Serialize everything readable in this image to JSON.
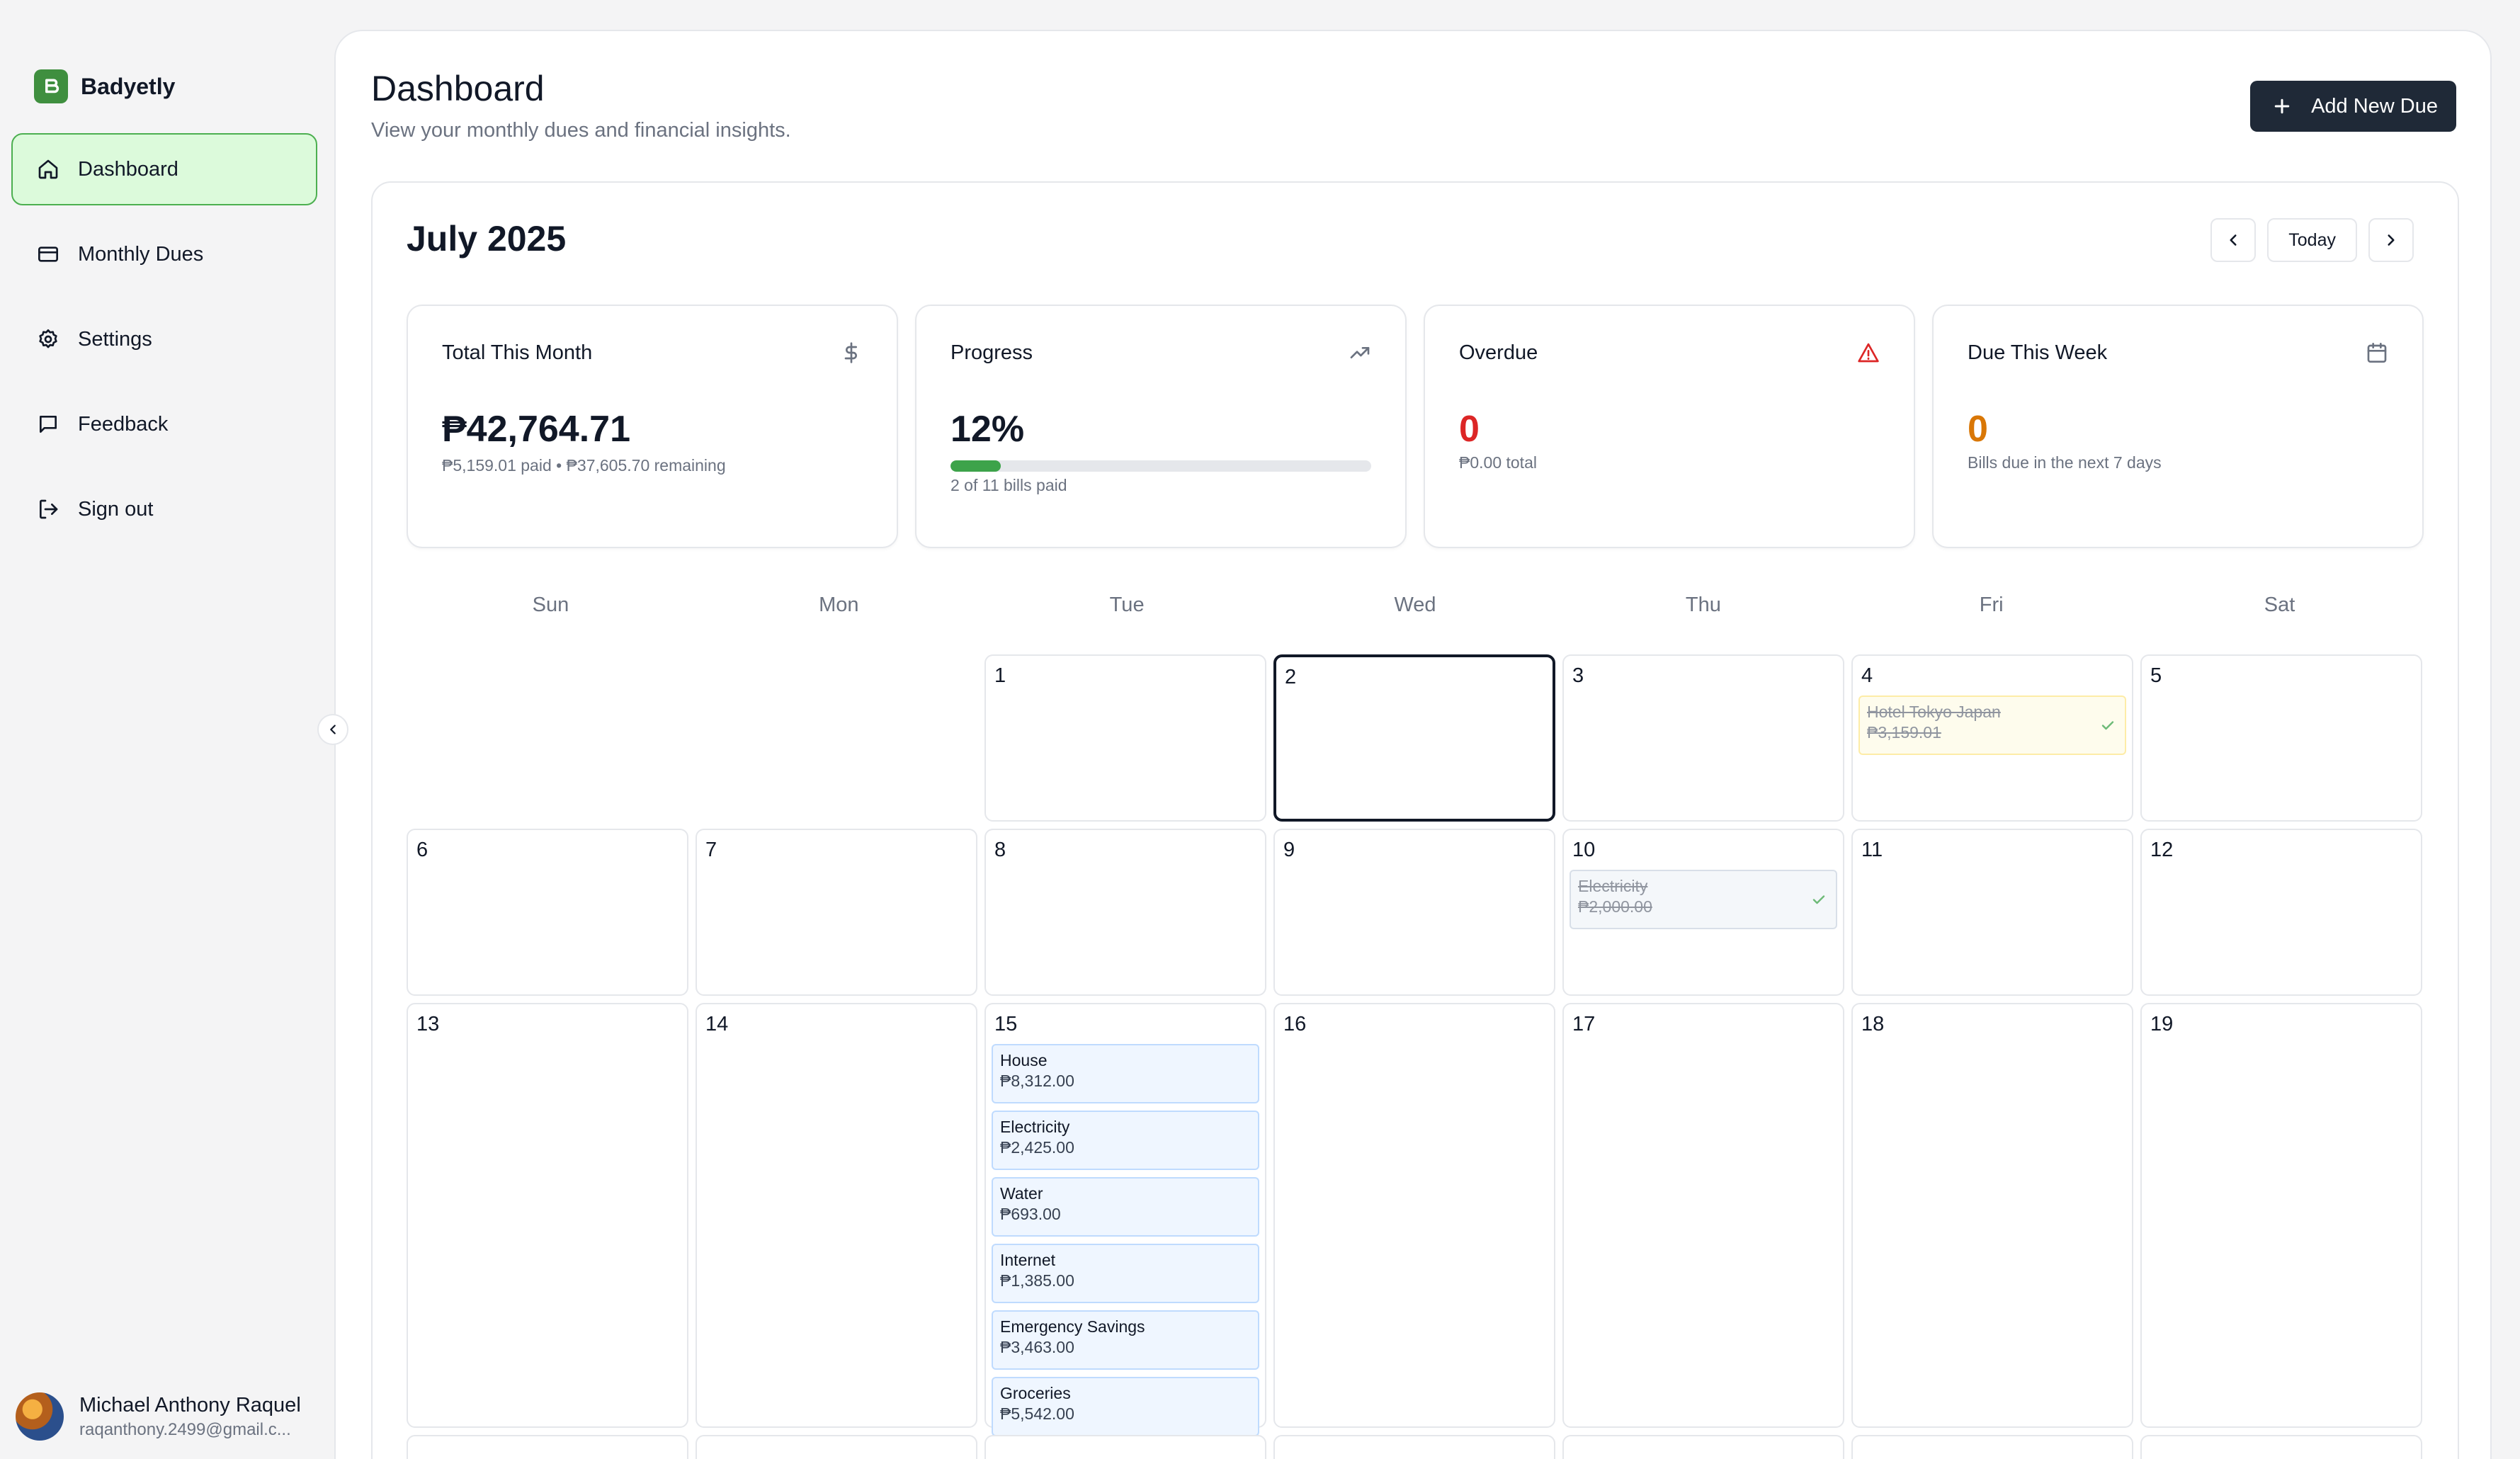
{
  "app": {
    "name": "Badyetly"
  },
  "sidebar": {
    "items": [
      {
        "label": "Dashboard",
        "icon": "home-icon",
        "active": true
      },
      {
        "label": "Monthly Dues",
        "icon": "credit-card-icon"
      },
      {
        "label": "Settings",
        "icon": "gear-icon"
      },
      {
        "label": "Feedback",
        "icon": "message-square-icon"
      },
      {
        "label": "Sign out",
        "icon": "log-out-icon"
      }
    ],
    "user": {
      "name": "Michael Anthony Raquel",
      "email": "raqanthony.2499@gmail.c..."
    }
  },
  "header": {
    "title": "Dashboard",
    "subtitle": "View your monthly dues and financial insights.",
    "add_button": "Add New Due"
  },
  "calendar": {
    "month_title": "July 2025",
    "today_label": "Today",
    "weekdays": [
      "Sun",
      "Mon",
      "Tue",
      "Wed",
      "Thu",
      "Fri",
      "Sat"
    ],
    "today_date": 2,
    "weeks": [
      [
        null,
        null,
        {
          "d": "1"
        },
        {
          "d": "2"
        },
        {
          "d": "3"
        },
        {
          "d": "4",
          "events": [
            {
              "name": "Hotel Tokyo Japan",
              "amount": "₱3,159.01",
              "paid": true,
              "color": "yellow"
            }
          ]
        },
        {
          "d": "5"
        }
      ],
      [
        {
          "d": "6"
        },
        {
          "d": "7"
        },
        {
          "d": "8"
        },
        {
          "d": "9"
        },
        {
          "d": "10",
          "events": [
            {
              "name": "Electricity",
              "amount": "₱2,000.00",
              "paid": true,
              "color": "gray"
            }
          ]
        },
        {
          "d": "11"
        },
        {
          "d": "12"
        }
      ],
      [
        {
          "d": "13"
        },
        {
          "d": "14"
        },
        {
          "d": "15",
          "events": [
            {
              "name": "House",
              "amount": "₱8,312.00"
            },
            {
              "name": "Electricity",
              "amount": "₱2,425.00"
            },
            {
              "name": "Water",
              "amount": "₱693.00"
            },
            {
              "name": "Internet",
              "amount": "₱1,385.00"
            },
            {
              "name": "Emergency Savings",
              "amount": "₱3,463.00"
            },
            {
              "name": "Groceries",
              "amount": "₱5,542.00"
            }
          ]
        },
        {
          "d": "16"
        },
        {
          "d": "17"
        },
        {
          "d": "18"
        },
        {
          "d": "19"
        }
      ]
    ]
  },
  "stats": {
    "total": {
      "label": "Total This Month",
      "value": "₱42,764.71",
      "sub": "₱5,159.01 paid • ₱37,605.70 remaining",
      "icon": "dollar-icon"
    },
    "progress": {
      "label": "Progress",
      "value": "12%",
      "percent": 12,
      "sub": "2 of 11 bills paid",
      "icon": "trending-up-icon"
    },
    "overdue": {
      "label": "Overdue",
      "value": "0",
      "sub": "₱0.00 total",
      "icon": "alert-triangle-icon",
      "color": "#dc2626"
    },
    "week": {
      "label": "Due This Week",
      "value": "0",
      "sub": "Bills due in the next 7 days",
      "icon": "calendar-icon",
      "color": "#d97706"
    }
  },
  "colors": {
    "brand": "#3f8f3f",
    "active_bg": "#dcfadb",
    "progress": "#3da34a"
  }
}
